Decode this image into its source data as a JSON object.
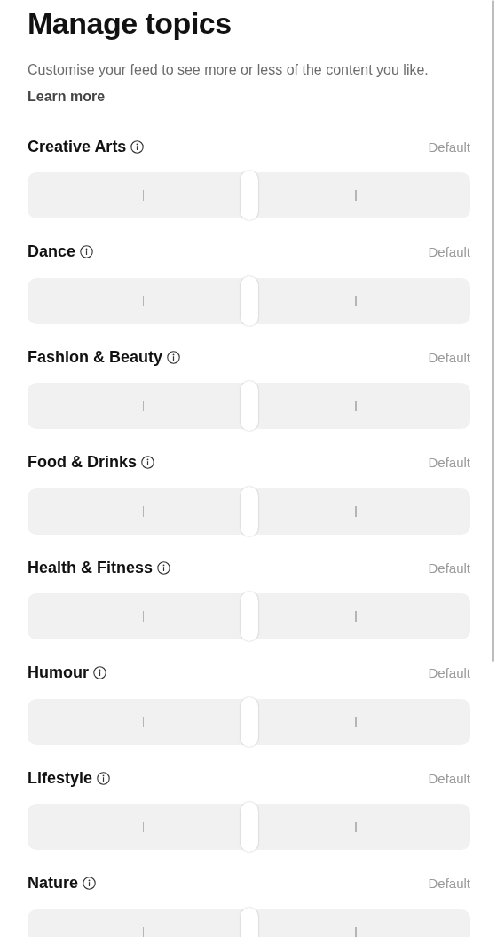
{
  "title": "Manage topics",
  "description": "Customise your feed to see more or less of the content you like.",
  "learn_more": "Learn more",
  "topics": [
    {
      "name": "Creative Arts",
      "status": "Default",
      "level": 0.5
    },
    {
      "name": "Dance",
      "status": "Default",
      "level": 0.5
    },
    {
      "name": "Fashion & Beauty",
      "status": "Default",
      "level": 0.5
    },
    {
      "name": "Food & Drinks",
      "status": "Default",
      "level": 0.5
    },
    {
      "name": "Health & Fitness",
      "status": "Default",
      "level": 0.5
    },
    {
      "name": "Humour",
      "status": "Default",
      "level": 0.5
    },
    {
      "name": "Lifestyle",
      "status": "Default",
      "level": 0.5
    },
    {
      "name": "Nature",
      "status": "Default",
      "level": 0.5
    }
  ]
}
